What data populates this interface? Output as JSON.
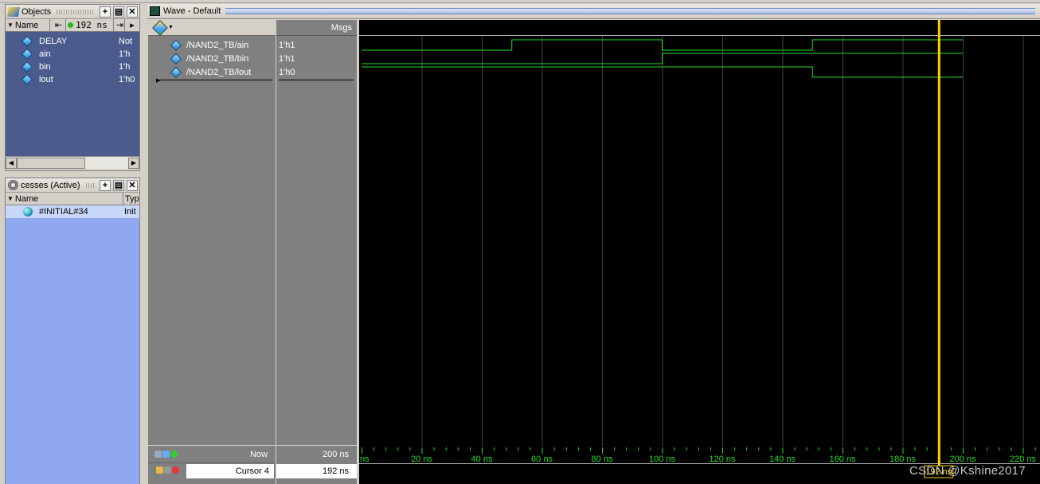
{
  "objects_pane": {
    "title": "Objects",
    "time_value": "192 ns",
    "col_name": "Name",
    "items": [
      {
        "name": "DELAY",
        "value": "Not"
      },
      {
        "name": "ain",
        "value": "1'h"
      },
      {
        "name": "bin",
        "value": "1'h"
      },
      {
        "name": "lout",
        "value": "1'h0"
      }
    ]
  },
  "processes_pane": {
    "title": "cesses (Active)",
    "col_name": "Name",
    "col_type": "Typ",
    "items": [
      {
        "name": "#INITIAL#34",
        "type": "Init"
      }
    ]
  },
  "wave_pane": {
    "title": "Wave - Default",
    "msgs_header": "Msgs",
    "signals": [
      {
        "name": "/NAND2_TB/ain",
        "msg": "1'h1"
      },
      {
        "name": "/NAND2_TB/bin",
        "msg": "1'h1"
      },
      {
        "name": "/NAND2_TB/lout",
        "msg": "1'h0"
      }
    ],
    "now_label": "Now",
    "now_value": "200 ns",
    "cursor_label": "Cursor 4",
    "cursor_value": "192 ns",
    "cursor_flag": "192 ns",
    "time_ticks": [
      "ns",
      "20 ns",
      "40 ns",
      "60 ns",
      "80 ns",
      "100 ns",
      "120 ns",
      "140 ns",
      "160 ns",
      "180 ns",
      "200 ns",
      "220 ns"
    ]
  },
  "watermark": "CSDN @Kshine2017",
  "colors": {
    "wave_green": "#22dd22",
    "cursor_yellow": "#ffd000",
    "grid": "#404040",
    "object_list_bg": "#4a5b8c",
    "process_list_bg": "#8fa8f0"
  }
}
